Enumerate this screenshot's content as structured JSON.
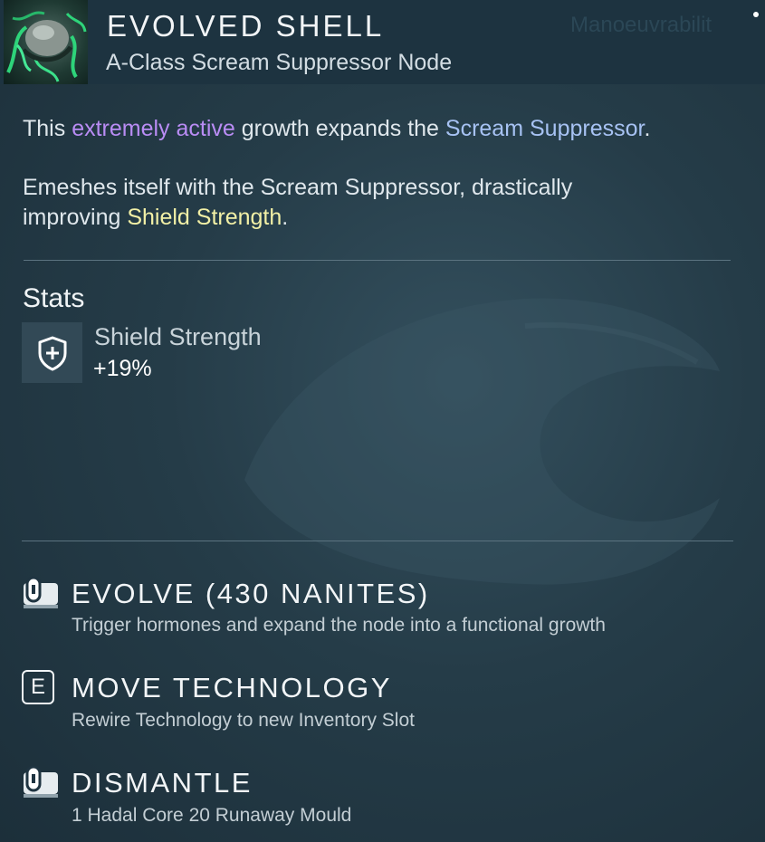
{
  "header": {
    "title": "EVOLVED SHELL",
    "subtitle": "A-Class Scream Suppressor Node",
    "faded_label": "Manoeuvrabilit",
    "icon": "organic-shell-node-icon"
  },
  "description": {
    "p1_prefix": "This ",
    "p1_highlight": "extremely active",
    "p1_middle": " growth expands the ",
    "p1_link": "Scream Suppressor",
    "p1_suffix": ".",
    "p2_prefix": "Emeshes itself with the Scream Suppressor, drastically improving ",
    "p2_highlight": "Shield Strength",
    "p2_suffix": "."
  },
  "stats": {
    "heading": "Stats",
    "items": [
      {
        "name": "Shield Strength",
        "value": "+19%",
        "icon": "shield-plus-icon"
      }
    ]
  },
  "actions": [
    {
      "title": "EVOLVE (430 NANITES)",
      "description": "Trigger hormones and expand the node into a functional growth",
      "icon": "mouse-left-click-icon"
    },
    {
      "title": "MOVE TECHNOLOGY",
      "description": "Rewire Technology to new Inventory Slot",
      "key": "E",
      "icon": "key-e-icon"
    },
    {
      "title": "DISMANTLE",
      "description": "1 Hadal Core 20 Runaway Mould",
      "icon": "mouse-left-click-icon"
    }
  ],
  "colors": {
    "highlight_purple": "#b98cf4",
    "highlight_blue": "#a7c2f3",
    "highlight_yellow": "#f2f0a6",
    "background": "#253c48"
  }
}
